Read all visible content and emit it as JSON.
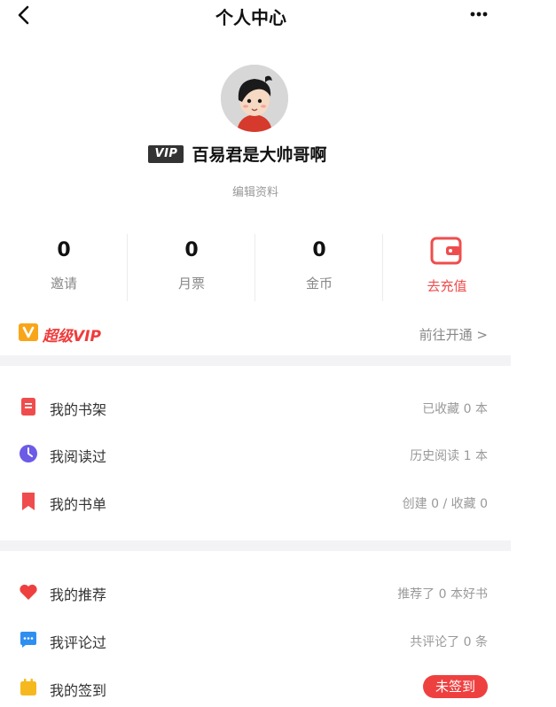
{
  "header": {
    "title": "个人中心"
  },
  "profile": {
    "vip_badge": "VIP",
    "name": "百易君是大帅哥啊",
    "edit_label": "编辑资料"
  },
  "stats": [
    {
      "value": "0",
      "label": "邀请"
    },
    {
      "value": "0",
      "label": "月票"
    },
    {
      "value": "0",
      "label": "金币"
    }
  ],
  "recharge": {
    "label": "去充值"
  },
  "vip_row": {
    "label": "超级VIP",
    "action": "前往开通 >"
  },
  "menu": [
    {
      "label": "我的书架",
      "value": "已收藏 0 本",
      "icon": "bookshelf-icon",
      "color": "#ef4d4d"
    },
    {
      "label": "我阅读过",
      "value": "历史阅读 1 本",
      "icon": "clock-icon",
      "color": "#6b5be6"
    },
    {
      "label": "我的书单",
      "value": "创建 0 / 收藏 0",
      "icon": "bookmark-icon",
      "color": "#ef4d4d"
    },
    {
      "label": "我的推荐",
      "value": "推荐了 0 本好书",
      "icon": "heart-icon",
      "color": "#ef4040"
    },
    {
      "label": "我评论过",
      "value": "共评论了 0 条",
      "icon": "comment-icon",
      "color": "#2f8ff0"
    },
    {
      "label": "我的签到",
      "value": "未签到",
      "icon": "checkin-icon",
      "color": "#f5b91f"
    }
  ],
  "colors": {
    "accent": "#ef4d4d",
    "vip_gold": "#f9a51a",
    "section_gap": "#f3f3f5"
  }
}
